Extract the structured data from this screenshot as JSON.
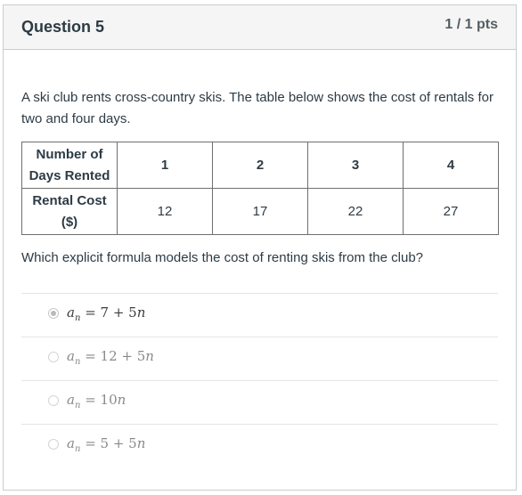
{
  "header": {
    "title": "Question 5",
    "points": "1 / 1 pts"
  },
  "prompt": "A ski club rents cross-country skis. The table below shows the cost of rentals for two and four days.",
  "table": {
    "rows": [
      {
        "label_line1": "Number of",
        "label_line2": "Days Rented",
        "values": [
          "1",
          "2",
          "3",
          "4"
        ]
      },
      {
        "label_line1": "Rental Cost",
        "label_line2": "($)",
        "values": [
          "12",
          "17",
          "22",
          "27"
        ]
      }
    ]
  },
  "question": "Which explicit formula models the cost of renting skis from the club?",
  "answers": [
    {
      "var": "a",
      "sub": "n",
      "rhs": "= 7 + 5",
      "tail": "n",
      "selected": true
    },
    {
      "var": "a",
      "sub": "n",
      "rhs": "= 12 + 5",
      "tail": "n",
      "selected": false
    },
    {
      "var": "a",
      "sub": "n",
      "rhs": "= 10",
      "tail": "n",
      "selected": false
    },
    {
      "var": "a",
      "sub": "n",
      "rhs": "= 5 + 5",
      "tail": "n",
      "selected": false
    }
  ]
}
